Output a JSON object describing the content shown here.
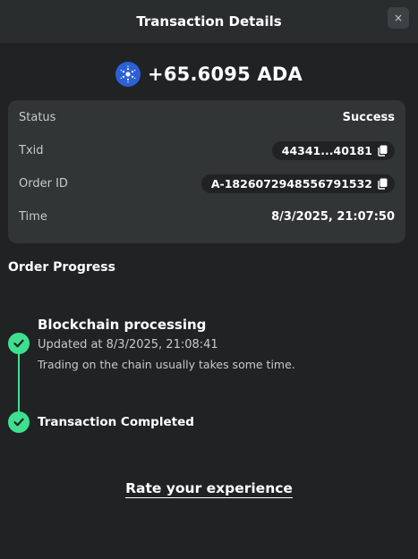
{
  "header": {
    "title": "Transaction Details",
    "close_label": "×"
  },
  "amount": {
    "text": "+65.6095 ADA",
    "icon": "cardano-icon",
    "icon_color": "#2c60d6"
  },
  "details": {
    "status_label": "Status",
    "status_value": "Success",
    "txid_label": "Txid",
    "txid_value": "44341...40181",
    "order_label": "Order ID",
    "order_value": "A-1826072948556791532",
    "time_label": "Time",
    "time_value": "8/3/2025, 21:07:50"
  },
  "progress": {
    "title": "Order Progress",
    "steps": [
      {
        "title": "Blockchain processing",
        "updated": "Updated at 8/3/2025, 21:08:41",
        "note": "Trading on the chain usually takes some time."
      },
      {
        "title": "Transaction Completed"
      }
    ],
    "accent_color": "#3ee08f"
  },
  "rate": {
    "label": "Rate your experience"
  }
}
